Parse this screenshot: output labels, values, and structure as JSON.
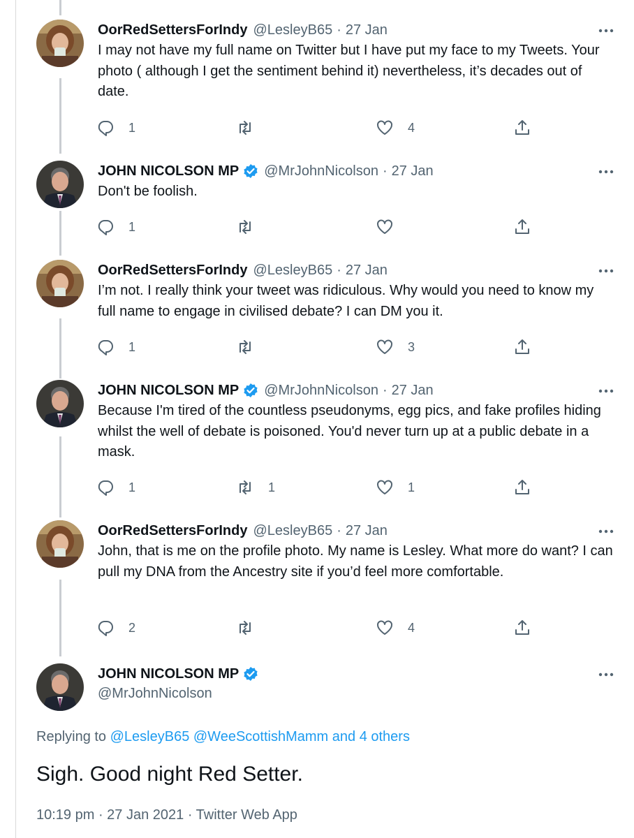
{
  "tweets": [
    {
      "name": "OorRedSettersForIndy",
      "handle": "@LesleyB65",
      "dot": "·",
      "date": "27 Jan",
      "verified": false,
      "text": "I may not have my full name on Twitter but I have put my face to my Tweets. Your photo ( although I get the sentiment behind it) nevertheless, it’s decades out of date.",
      "replies": "1",
      "retweets": "",
      "likes": "4"
    },
    {
      "name": "JOHN NICOLSON MP",
      "handle": "@MrJohnNicolson",
      "dot": "·",
      "date": "27 Jan",
      "verified": true,
      "text": "Don't be foolish.",
      "replies": "1",
      "retweets": "",
      "likes": ""
    },
    {
      "name": "OorRedSettersForIndy",
      "handle": "@LesleyB65",
      "dot": "·",
      "date": "27 Jan",
      "verified": false,
      "text": "I’m not. I really think your tweet was ridiculous. Why would you need to know my full name to engage in civilised debate? I can DM you it.",
      "replies": "1",
      "retweets": "",
      "likes": "3"
    },
    {
      "name": "JOHN NICOLSON MP",
      "handle": "@MrJohnNicolson",
      "dot": "·",
      "date": "27 Jan",
      "verified": true,
      "text": "Because I'm tired of the countless pseudonyms, egg pics, and fake profiles hiding whilst the well of debate is poisoned. You'd never turn up at a public debate in a mask.",
      "replies": "1",
      "retweets": "1",
      "likes": "1"
    },
    {
      "name": "OorRedSettersForIndy",
      "handle": "@LesleyB65",
      "dot": "·",
      "date": "27 Jan",
      "verified": false,
      "text": "John, that is me on the profile photo. My name is Lesley. What more do want? I can pull my DNA from the Ancestry site if you’d feel more comfortable.",
      "replies": "2",
      "retweets": "",
      "likes": "4"
    }
  ],
  "main_tweet": {
    "name": "JOHN NICOLSON MP",
    "handle": "@MrJohnNicolson",
    "replying_prefix": "Replying to",
    "replying_users": "@LesleyB65 @WeeScottishMamm",
    "replying_others": "and 4 others",
    "text": "Sigh. Good night Red Setter.",
    "timestamp": "10:19 pm · 27 Jan 2021 · Twitter Web App"
  },
  "icons": {
    "reply": "reply-icon",
    "retweet": "retweet-icon",
    "like": "heart-icon",
    "share": "share-icon",
    "more": "more-options-icon",
    "verified": "verified-badge-icon"
  },
  "colors": {
    "text": "#0f1419",
    "secondary": "#536471",
    "link": "#1d9bf0",
    "verified": "#1d9bf0",
    "thread_line": "#c9cdd1"
  }
}
